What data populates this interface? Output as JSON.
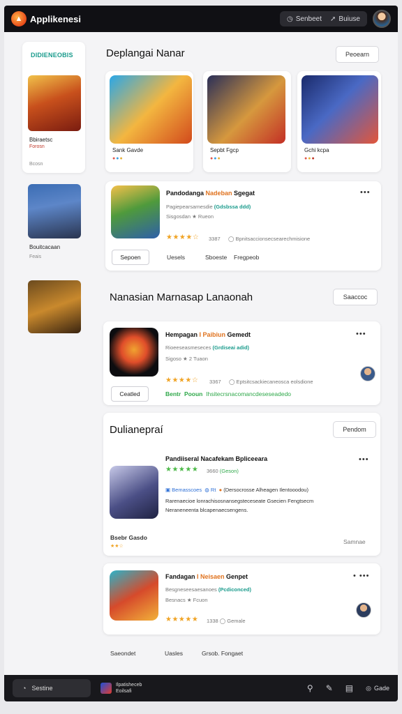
{
  "app": {
    "name": "Applikenesi"
  },
  "topbar": {
    "btn1": {
      "label": "Senbeet",
      "icon": "clock-icon"
    },
    "btn2": {
      "label": "Buiuse",
      "icon": "rocket-icon"
    }
  },
  "sidebar": {
    "heading": "DIDIENEOBIS",
    "items": [
      {
        "title": "Bbiraetsc",
        "sub": "Forosn",
        "extra": "Bcosn"
      },
      {
        "title": "Bouitcacaan",
        "sub": "Feais"
      },
      {
        "title": ""
      }
    ]
  },
  "section1": {
    "title": "Deplangai Nanar",
    "button": "Peoearn",
    "featured": [
      {
        "name": "Sank Gavde"
      },
      {
        "name": "Sepbt Fgcp"
      },
      {
        "name": "Gchi kcpa"
      }
    ],
    "row": {
      "title_a": "Pandodanga ",
      "title_b": "Nadeban",
      "title_c": " Sgegat",
      "line1_a": "Pagiepearsarnesdie  ",
      "line1_b": "(Gdsbssa ddd)",
      "line2": "Sisgosdan  ★ Rueon",
      "stars": "★★★★☆",
      "rating": "3387",
      "meta": "Bpnitsaccionsecsearechmisione",
      "btn": "Sepoen",
      "link1": "Uesels",
      "link2": "Sboeste",
      "link3": "Fregpeob"
    }
  },
  "section2": {
    "title": "Nanasian Marnasap Lanaonah",
    "button": "Saaccoc",
    "row": {
      "title_a": "Hempagan ",
      "title_b": "I Paibiun",
      "title_c": " Gemedt",
      "line1_a": "Rioeeseasmeseces  ",
      "line1_b": "(Grdiseai adid)",
      "line2": "Sigoso ★ 2 Tuaon",
      "stars": "★★★★☆",
      "rating": "3367",
      "meta": "Eptsitcsackiecaneosca eolsdione",
      "btn": "Ceatled",
      "green_a": "Bentr",
      "green_b": "Pooun",
      "green_c": "Ihsitecrsnacomancdeseseadedo"
    }
  },
  "section3": {
    "title": "Dulianepraí",
    "button": "Pendom",
    "row1": {
      "title": "Pandiiseral Nacafekam Bpliceeara",
      "stars": "★★★★★",
      "rating": "3660",
      "rating_tag": "Geson",
      "tag1": "Bemasscoes",
      "tag2": "Rt",
      "desc1": "(Dersocrosse Alheagen Ilentooodou)",
      "desc2": "Rarenaecioe lonrachisosnansegsteceseate Gsecien Fengtsecm",
      "desc3": "Neraneneenta blcapenaecsengens.",
      "foot_title": "Bsebr Gasdo",
      "foot_link": "Samnae"
    },
    "row2": {
      "title_a": "Fandagan ",
      "title_b": "I Neisaen",
      "title_c": " Genpet",
      "line1_a": "Besgneseesaesanoes  ",
      "line1_b": "(Pcdiconced)",
      "line2": "Besnacs  ★ Fcuon",
      "stars": "★★★★★",
      "rating": "1338",
      "tag": "Gemale"
    },
    "links": {
      "a": "Saeondet",
      "b": "Uasles",
      "c": "Grsob. Fongaet"
    }
  },
  "bottombar": {
    "search": "Sestine",
    "app_line1": "Ilpatisheceb",
    "app_line2": "Eoilsafi",
    "last": "Gade"
  }
}
